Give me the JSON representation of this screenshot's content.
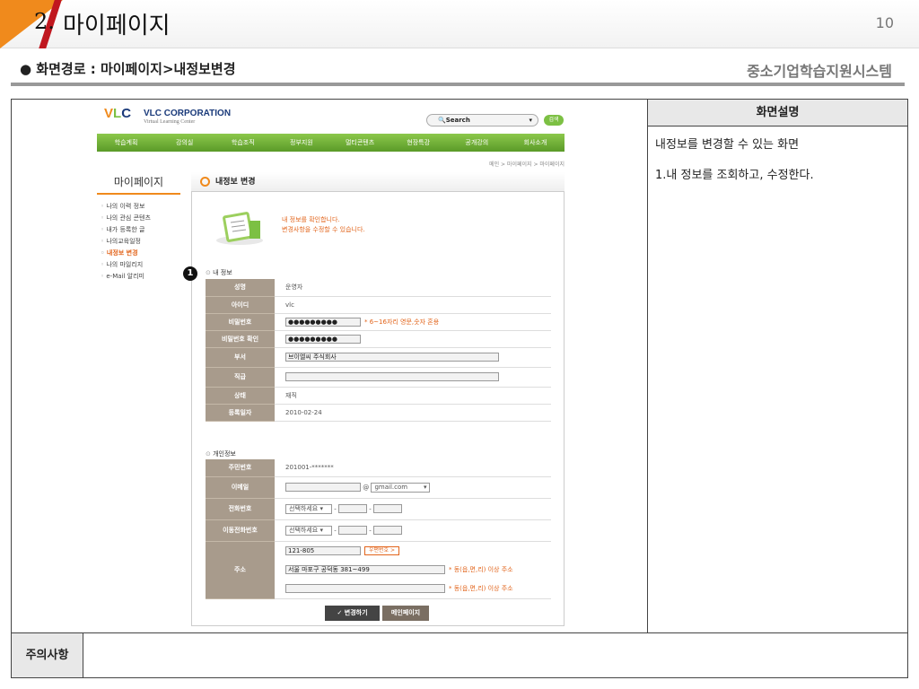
{
  "slide": {
    "number": "2.",
    "title": "마이페이지",
    "page": "10"
  },
  "path_label": "● 화면경로 : 마이페이지>내정보변경",
  "system_name": "중소기업학습지원시스템",
  "desc": {
    "header": "화면설명",
    "line1": "내정보를 변경할 수 있는 화면",
    "line2": "1.내 정보를 조회하고, 수정한다."
  },
  "note_label": "주의사항",
  "site": {
    "logo_main": "VLC",
    "logo_corp": "VLC CORPORATION",
    "logo_sub": "Virtual Learning Center",
    "search_placeholder": "Search",
    "search_button": "검색",
    "nav": [
      "학습계획",
      "강의실",
      "학습조직",
      "정부지원",
      "멀티콘텐츠",
      "현장특강",
      "공개강의",
      "회사소개"
    ],
    "breadcrumb": "메인 > 마이페이지 > 마이페이지",
    "sidebar_title": "마이페이지",
    "sidebar": [
      "나의 이력 정보",
      "나의 관심 콘텐츠",
      "내가 등록한 글",
      "나의교육일정",
      "내정보 변경",
      "나의 마일리지",
      "e-Mail 알리미"
    ],
    "main_title": "내정보 변경",
    "intro1": "내 정보를 확인합니다.",
    "intro2": "변경사항을 수정할 수 있습니다.",
    "badge": "1",
    "section1": "내 정보",
    "section2": "개인정보",
    "my_info": {
      "name_label": "성명",
      "name": "운영자",
      "id_label": "아이디",
      "id": "vlc",
      "pw_label": "비밀번호",
      "pw": "●●●●●●●●●",
      "pw_hint": "* 6~16자리 영문,숫자 혼용",
      "pw2_label": "비밀번호 확인",
      "pw2": "●●●●●●●●●",
      "dept_label": "부서",
      "dept": "브이엘씨 주식회사",
      "rank_label": "직급",
      "rank": "",
      "status_label": "상태",
      "status": "재직",
      "reg_label": "등록일자",
      "reg": "2010-02-24"
    },
    "personal": {
      "ssn_label": "주민번호",
      "ssn": "201001-*******",
      "email_label": "이메일",
      "email_at": "@",
      "email_domain": "gmail.com",
      "phone_label": "전화번호",
      "phone_select": "선택하세요",
      "mobile_label": "이동전화번호",
      "mobile_select": "선택하세요",
      "addr_label": "주소",
      "zip": "121-805",
      "zip_btn": "우편번호 >",
      "addr1": "서울 마포구 공덕동 381~499",
      "addr_hint": "* 동(읍,면,리) 이상 주소",
      "addr2": ""
    },
    "btn_change": "✓ 변경하기",
    "btn_main": "메인페이지"
  }
}
